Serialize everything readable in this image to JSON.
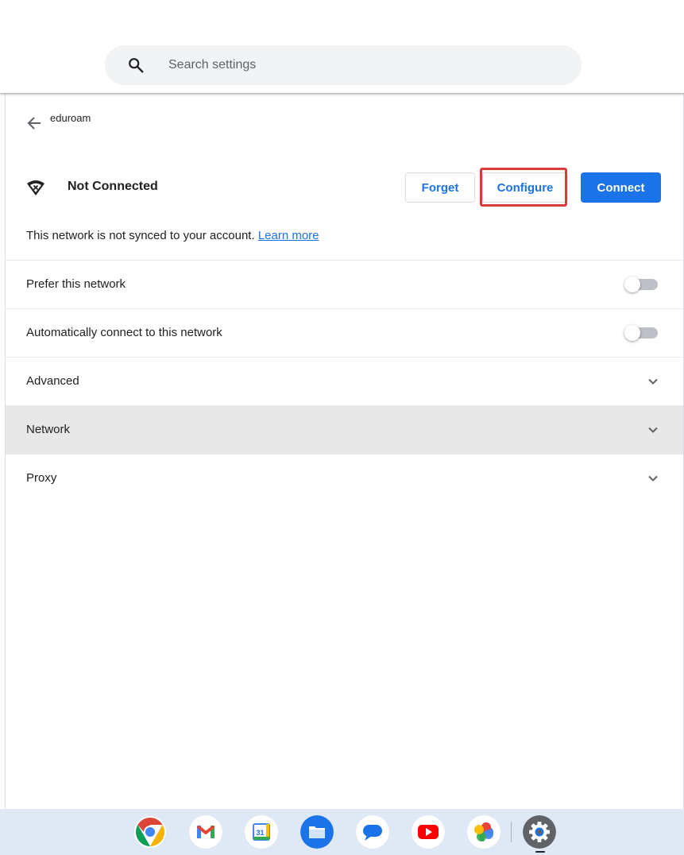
{
  "search": {
    "placeholder": "Search settings",
    "value": ""
  },
  "page": {
    "breadcrumb_title": "eduroam"
  },
  "network": {
    "status": "Not Connected",
    "buttons": {
      "forget": "Forget",
      "configure": "Configure",
      "connect": "Connect"
    },
    "sync_note": "This network is not synced to your account.",
    "learn_more": "Learn more"
  },
  "rows": [
    {
      "label": "Prefer this network",
      "control": "toggle",
      "on": false
    },
    {
      "label": "Automatically connect to this network",
      "control": "toggle",
      "on": false
    },
    {
      "label": "Advanced",
      "control": "chevron"
    },
    {
      "label": "Network",
      "control": "chevron"
    },
    {
      "label": "Proxy",
      "control": "chevron"
    }
  ],
  "shelf": {
    "apps": [
      "chrome-icon",
      "gmail-icon",
      "calendar-icon",
      "files-icon",
      "messages-icon",
      "youtube-icon",
      "photos-icon",
      "settings-icon"
    ],
    "calendar_date": "31"
  },
  "colors": {
    "accent": "#1a73e8",
    "highlight_box": "#d93a3a",
    "shelf_bg": "#dfe8f5",
    "active_row": "#e8e8e8"
  }
}
